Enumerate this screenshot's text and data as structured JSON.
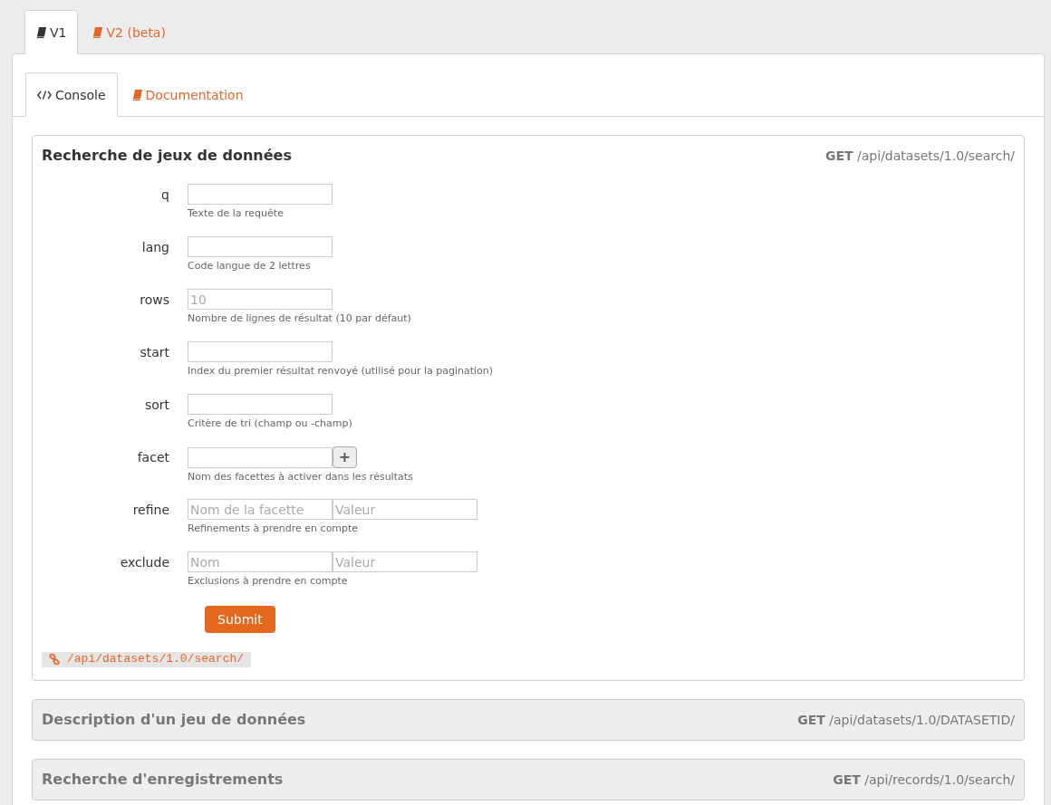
{
  "version_tabs": [
    {
      "label": "V1",
      "selected": true
    },
    {
      "label": "V2 (beta)",
      "selected": false
    }
  ],
  "console_tabs": [
    {
      "label": "Console",
      "selected": true
    },
    {
      "label": "Documentation",
      "selected": false
    }
  ],
  "sections": [
    {
      "title": "Recherche de jeux de données",
      "method": "GET",
      "path": "/api/datasets/1.0/search/",
      "expanded": true,
      "fields": [
        {
          "label": "q",
          "kind": "single",
          "help": "Texte de la requête"
        },
        {
          "label": "lang",
          "kind": "single",
          "help": "Code langue de 2 lettres"
        },
        {
          "label": "rows",
          "kind": "single",
          "help": "Nombre de lignes de résultat (10 par défaut)",
          "placeholder": "10"
        },
        {
          "label": "start",
          "kind": "single",
          "help": "Index du premier résultat renvoyé (utilisé pour la pagination)"
        },
        {
          "label": "sort",
          "kind": "single",
          "help": "Critère de tri (champ ou -champ)"
        },
        {
          "label": "facet",
          "kind": "addable",
          "help": "Nom des facettes à activer dans les résultats",
          "add_button": "+"
        },
        {
          "label": "refine",
          "kind": "pair",
          "help": "Refinements à prendre en compte",
          "placeholders": [
            "Nom de la facette",
            "Valeur"
          ]
        },
        {
          "label": "exclude",
          "kind": "pair",
          "help": "Exclusions à prendre en compte",
          "placeholders": [
            "Nom",
            "Valeur"
          ]
        }
      ],
      "submit": "Submit",
      "url": "/api/datasets/1.0/search/"
    },
    {
      "title": "Description d'un jeu de données",
      "method": "GET",
      "path": "/api/datasets/1.0/DATASETID/",
      "expanded": false
    },
    {
      "title": "Recherche d'enregistrements",
      "method": "GET",
      "path": "/api/records/1.0/search/",
      "expanded": false
    }
  ]
}
